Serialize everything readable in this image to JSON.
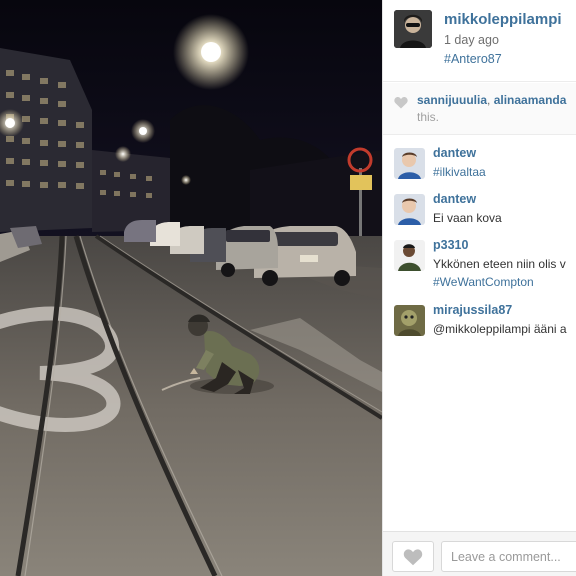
{
  "post": {
    "username": "mikkoleppilampi",
    "time_ago": "1 day ago",
    "hashtag": "#Antero87"
  },
  "likes": {
    "likers": [
      "sannijuuulia",
      "alinaamanda"
    ],
    "separator": ",",
    "rest": "this.",
    "icon": "heart-icon"
  },
  "comments": [
    {
      "user": "dantew",
      "text": "#ilkivaltaa",
      "text_is_tag": true
    },
    {
      "user": "dantew",
      "text": "Ei vaan kova",
      "text_is_tag": false
    },
    {
      "user": "p3310",
      "text": "Ykkönen eteen niin olis v",
      "text_is_tag": false,
      "text2": "#WeWantCompton"
    },
    {
      "user": "mirajussila87",
      "text": "@mikkoleppilampi ääni a",
      "text_is_tag": false
    }
  ],
  "footer": {
    "like_button_icon": "heart-icon",
    "comment_placeholder": "Leave a comment..."
  },
  "colors": {
    "link": "#3f729b",
    "meta": "#6f6f6f",
    "footer_bg": "#f5f5f5"
  }
}
